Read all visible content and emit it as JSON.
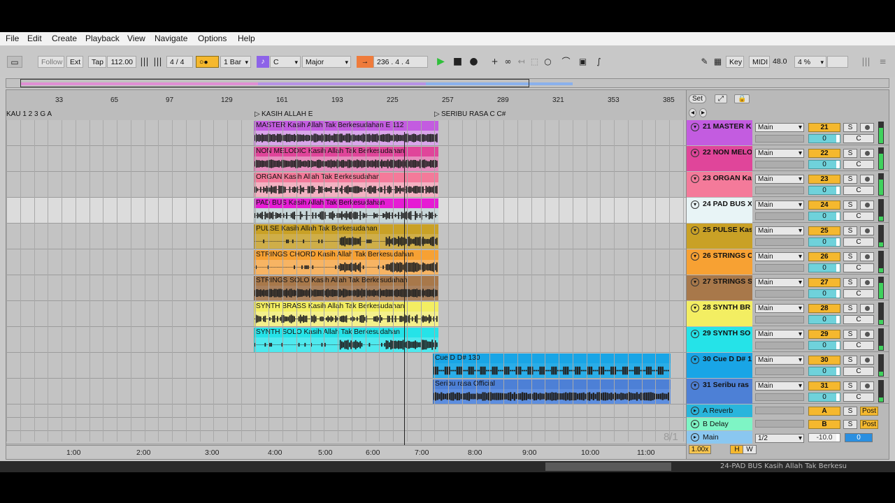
{
  "menu": [
    "File",
    "Edit",
    "Create",
    "Playback",
    "View",
    "Navigate",
    "Options",
    "Help"
  ],
  "control_bar": {
    "follow": "Follow",
    "ext": "Ext",
    "tap": "Tap",
    "tempo": "112.00",
    "signature": "4 / 4",
    "quantize": "1 Bar",
    "scale_key": "C",
    "scale_mode": "Major",
    "position": "236 .   4 .   4",
    "key": "Key",
    "midi": "MIDI",
    "midi_value": "48.0",
    "cpu": "4 %"
  },
  "ruler": {
    "bars": [
      "33",
      "65",
      "97",
      "129",
      "161",
      "193",
      "225",
      "257",
      "289",
      "321",
      "353",
      "385"
    ],
    "set_label": "Set"
  },
  "locators": [
    "KAU 1 2 3 G A",
    "KASIH ALLAH E",
    "SERIBU RASA C C#"
  ],
  "tracks": [
    {
      "num": "21",
      "name": "21 MASTER K",
      "route": "Main",
      "vol": "0",
      "color": "#c35ce0",
      "light": "#d9a6ea",
      "clip": "MASTER Kasih Allah Tak Berkesudahan E 112",
      "start": 0,
      "wave": "dense"
    },
    {
      "num": "22",
      "name": "22 NON MELO",
      "route": "Main",
      "vol": "0",
      "color": "#e0459a",
      "light": "#e68cbd",
      "clip": "NON MELODIC Kasih Allah Tak Berkesudahan",
      "start": 0,
      "wave": "dense"
    },
    {
      "num": "23",
      "name": "23 ORGAN Ka",
      "route": "Main",
      "vol": "0",
      "color": "#f47a9a",
      "light": "#f3b2c2",
      "clip": "ORGAN Kasih Allah Tak Berkesudahan",
      "start": 0,
      "wave": "mid"
    },
    {
      "num": "24",
      "name": "24 PAD BUS X",
      "route": "Main",
      "vol": "0",
      "color": "#e61cd4",
      "light": "#c7d6d8",
      "clip": "PAD BUS Kasih Allah Tak Berkesudahan",
      "start": 0,
      "wave": "mid"
    },
    {
      "num": "25",
      "name": "25 PULSE Kas",
      "route": "Main",
      "vol": "0",
      "color": "#c9a126",
      "light": "#cfae48",
      "clip": "PULSE Kasih Allah Tak Berkesudahan",
      "start": 0,
      "wave": "sparse"
    },
    {
      "num": "26",
      "name": "26 STRINGS C",
      "route": "Main",
      "vol": "0",
      "color": "#f7a133",
      "light": "#f7b463",
      "clip": "STRINGS CHORD Kasih Allah Tak Berkesudahan",
      "start": 0,
      "wave": "sparse"
    },
    {
      "num": "27",
      "name": "27 STRINGS S",
      "route": "Main",
      "vol": "0",
      "color": "#a8784a",
      "light": "#a9805c",
      "clip": "STRINGS SOLO Kasih Allah Tak Berkesudahan",
      "start": 0,
      "wave": "dense"
    },
    {
      "num": "28",
      "name": "28 SYNTH BR",
      "route": "Main",
      "vol": "0",
      "color": "#f3ee62",
      "light": "#f4f08c",
      "clip": "SYNTH BRASS Kasih Allah Tak Berkesudahan",
      "start": 0,
      "wave": "mid"
    },
    {
      "num": "29",
      "name": "29 SYNTH SO",
      "route": "Main",
      "vol": "0",
      "color": "#25e3e8",
      "light": "#4fe9ee",
      "clip": "SYNTH SOLO Kasih Allah Tak Berkesudahan",
      "start": 0,
      "wave": "sparse"
    },
    {
      "num": "30",
      "name": "30 Cue D D# 1",
      "route": "Main",
      "vol": "0",
      "color": "#19a5e6",
      "light": "#29ade8",
      "clip": "Cue D D# 130",
      "start": 1,
      "wave": "cue"
    },
    {
      "num": "31",
      "name": "31 Seribu ras",
      "route": "Main",
      "vol": "0",
      "color": "#4d80d6",
      "light": "#5d8ee0",
      "clip": "Seribu rasa Official",
      "start": 1,
      "wave": "dense"
    }
  ],
  "returns": [
    {
      "name": "A Reverb",
      "label": "A",
      "post": "Post",
      "color": "#29b5dc"
    },
    {
      "name": "B Delay",
      "label": "B",
      "post": "Post",
      "color": "#7ef5c5"
    }
  ],
  "main": {
    "name": "Main",
    "route": "1/2",
    "vol": "-10.0",
    "pan": "0",
    "color": "#8ac7f0"
  },
  "scene": "8/1",
  "zoom": "1.00x",
  "h_label": "H",
  "w_label": "W",
  "time_ruler": [
    "1:00",
    "2:00",
    "3:00",
    "4:00",
    "5:00",
    "6:00",
    "7:00",
    "8:00",
    "9:00",
    "10:00",
    "11:00"
  ],
  "solo_label": "S",
  "c_label": "C",
  "bottom_label": "24-PAD BUS Kasih Allah Tak Berkesu"
}
